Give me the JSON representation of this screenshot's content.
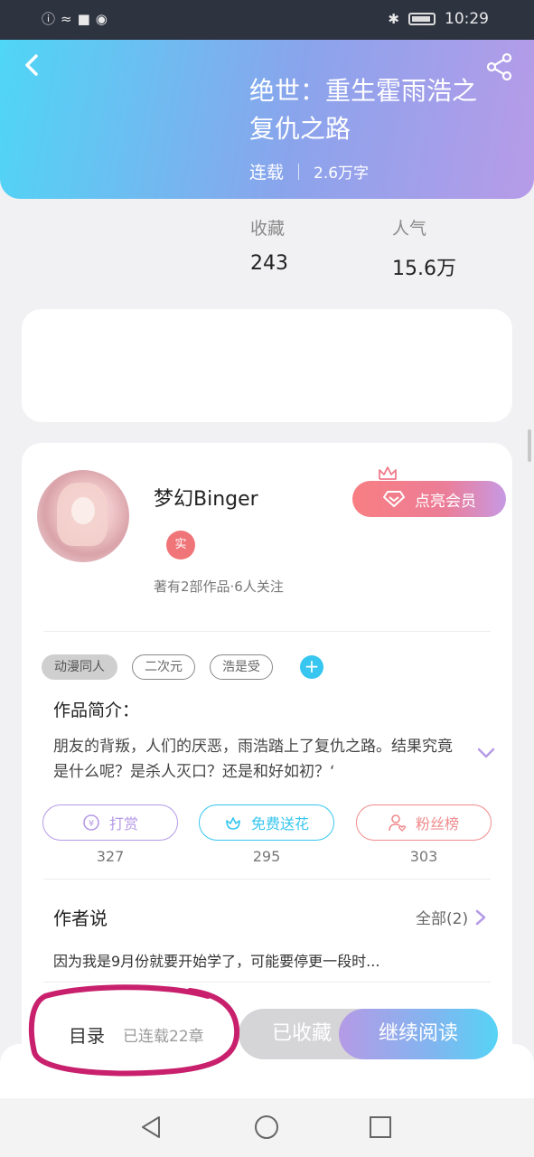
{
  "statusbar": {
    "time": "10:29"
  },
  "book": {
    "title": "绝世：重生霍雨浩之复仇之路",
    "status": "连载",
    "words": "2.6万字"
  },
  "stats": [
    {
      "label": "收藏",
      "value": "243"
    },
    {
      "label": "人气",
      "value": "15.6万"
    }
  ],
  "author": {
    "name": "梦幻Binger",
    "badge": "实",
    "sub": "著有2部作品·6人关注",
    "vip_label": "点亮会员"
  },
  "tags": [
    "动漫同人",
    "二次元",
    "浩是受"
  ],
  "intro": {
    "title": "作品简介：",
    "text": "朋友的背叛，人们的厌恶，雨浩踏上了复仇之路。结果究竟是什么呢？是杀人灭口？还是和好如初？‘"
  },
  "actions": [
    {
      "label": "打赏",
      "count": "327",
      "color": "#b59ae6"
    },
    {
      "label": "免费送花",
      "count": "295",
      "color": "#36c6ef"
    },
    {
      "label": "粉丝榜",
      "count": "303",
      "color": "#ef8a8c"
    }
  ],
  "author_say": {
    "title": "作者说",
    "all_label": "全部(2)",
    "text": "因为我是9月份就要开始学了，可能要停更一段时..."
  },
  "bottom": {
    "toc_label": "目录",
    "toc_sub": "已连载22章",
    "collected_label": "已收藏",
    "continue_label": "继续阅读"
  },
  "colors": {
    "annotation": "#c8206d"
  }
}
